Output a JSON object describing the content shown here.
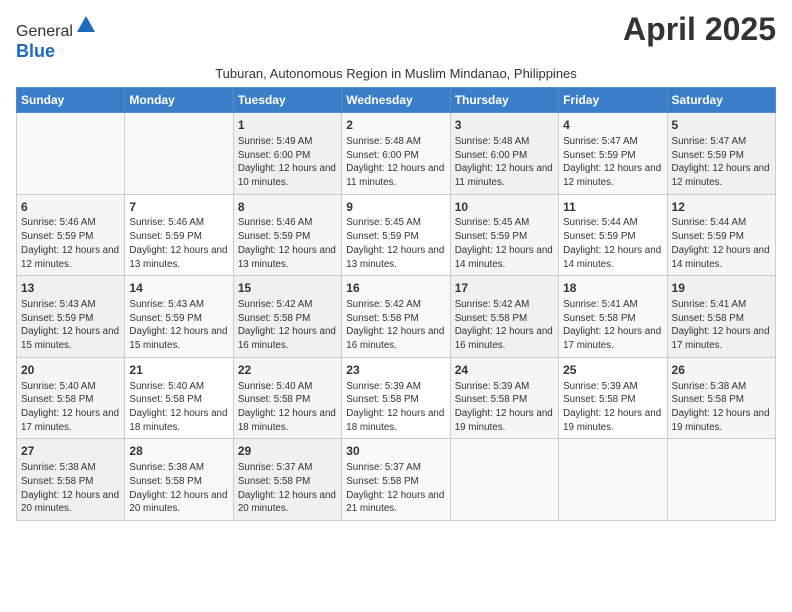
{
  "header": {
    "logo_line1": "General",
    "logo_line2": "Blue",
    "title": "April 2025",
    "subtitle": "Tuburan, Autonomous Region in Muslim Mindanao, Philippines"
  },
  "days_of_week": [
    "Sunday",
    "Monday",
    "Tuesday",
    "Wednesday",
    "Thursday",
    "Friday",
    "Saturday"
  ],
  "weeks": [
    [
      {
        "day": "",
        "info": ""
      },
      {
        "day": "",
        "info": ""
      },
      {
        "day": "1",
        "info": "Sunrise: 5:49 AM\nSunset: 6:00 PM\nDaylight: 12 hours and 10 minutes."
      },
      {
        "day": "2",
        "info": "Sunrise: 5:48 AM\nSunset: 6:00 PM\nDaylight: 12 hours and 11 minutes."
      },
      {
        "day": "3",
        "info": "Sunrise: 5:48 AM\nSunset: 6:00 PM\nDaylight: 12 hours and 11 minutes."
      },
      {
        "day": "4",
        "info": "Sunrise: 5:47 AM\nSunset: 5:59 PM\nDaylight: 12 hours and 12 minutes."
      },
      {
        "day": "5",
        "info": "Sunrise: 5:47 AM\nSunset: 5:59 PM\nDaylight: 12 hours and 12 minutes."
      }
    ],
    [
      {
        "day": "6",
        "info": "Sunrise: 5:46 AM\nSunset: 5:59 PM\nDaylight: 12 hours and 12 minutes."
      },
      {
        "day": "7",
        "info": "Sunrise: 5:46 AM\nSunset: 5:59 PM\nDaylight: 12 hours and 13 minutes."
      },
      {
        "day": "8",
        "info": "Sunrise: 5:46 AM\nSunset: 5:59 PM\nDaylight: 12 hours and 13 minutes."
      },
      {
        "day": "9",
        "info": "Sunrise: 5:45 AM\nSunset: 5:59 PM\nDaylight: 12 hours and 13 minutes."
      },
      {
        "day": "10",
        "info": "Sunrise: 5:45 AM\nSunset: 5:59 PM\nDaylight: 12 hours and 14 minutes."
      },
      {
        "day": "11",
        "info": "Sunrise: 5:44 AM\nSunset: 5:59 PM\nDaylight: 12 hours and 14 minutes."
      },
      {
        "day": "12",
        "info": "Sunrise: 5:44 AM\nSunset: 5:59 PM\nDaylight: 12 hours and 14 minutes."
      }
    ],
    [
      {
        "day": "13",
        "info": "Sunrise: 5:43 AM\nSunset: 5:59 PM\nDaylight: 12 hours and 15 minutes."
      },
      {
        "day": "14",
        "info": "Sunrise: 5:43 AM\nSunset: 5:59 PM\nDaylight: 12 hours and 15 minutes."
      },
      {
        "day": "15",
        "info": "Sunrise: 5:42 AM\nSunset: 5:58 PM\nDaylight: 12 hours and 16 minutes."
      },
      {
        "day": "16",
        "info": "Sunrise: 5:42 AM\nSunset: 5:58 PM\nDaylight: 12 hours and 16 minutes."
      },
      {
        "day": "17",
        "info": "Sunrise: 5:42 AM\nSunset: 5:58 PM\nDaylight: 12 hours and 16 minutes."
      },
      {
        "day": "18",
        "info": "Sunrise: 5:41 AM\nSunset: 5:58 PM\nDaylight: 12 hours and 17 minutes."
      },
      {
        "day": "19",
        "info": "Sunrise: 5:41 AM\nSunset: 5:58 PM\nDaylight: 12 hours and 17 minutes."
      }
    ],
    [
      {
        "day": "20",
        "info": "Sunrise: 5:40 AM\nSunset: 5:58 PM\nDaylight: 12 hours and 17 minutes."
      },
      {
        "day": "21",
        "info": "Sunrise: 5:40 AM\nSunset: 5:58 PM\nDaylight: 12 hours and 18 minutes."
      },
      {
        "day": "22",
        "info": "Sunrise: 5:40 AM\nSunset: 5:58 PM\nDaylight: 12 hours and 18 minutes."
      },
      {
        "day": "23",
        "info": "Sunrise: 5:39 AM\nSunset: 5:58 PM\nDaylight: 12 hours and 18 minutes."
      },
      {
        "day": "24",
        "info": "Sunrise: 5:39 AM\nSunset: 5:58 PM\nDaylight: 12 hours and 19 minutes."
      },
      {
        "day": "25",
        "info": "Sunrise: 5:39 AM\nSunset: 5:58 PM\nDaylight: 12 hours and 19 minutes."
      },
      {
        "day": "26",
        "info": "Sunrise: 5:38 AM\nSunset: 5:58 PM\nDaylight: 12 hours and 19 minutes."
      }
    ],
    [
      {
        "day": "27",
        "info": "Sunrise: 5:38 AM\nSunset: 5:58 PM\nDaylight: 12 hours and 20 minutes."
      },
      {
        "day": "28",
        "info": "Sunrise: 5:38 AM\nSunset: 5:58 PM\nDaylight: 12 hours and 20 minutes."
      },
      {
        "day": "29",
        "info": "Sunrise: 5:37 AM\nSunset: 5:58 PM\nDaylight: 12 hours and 20 minutes."
      },
      {
        "day": "30",
        "info": "Sunrise: 5:37 AM\nSunset: 5:58 PM\nDaylight: 12 hours and 21 minutes."
      },
      {
        "day": "",
        "info": ""
      },
      {
        "day": "",
        "info": ""
      },
      {
        "day": "",
        "info": ""
      }
    ]
  ]
}
